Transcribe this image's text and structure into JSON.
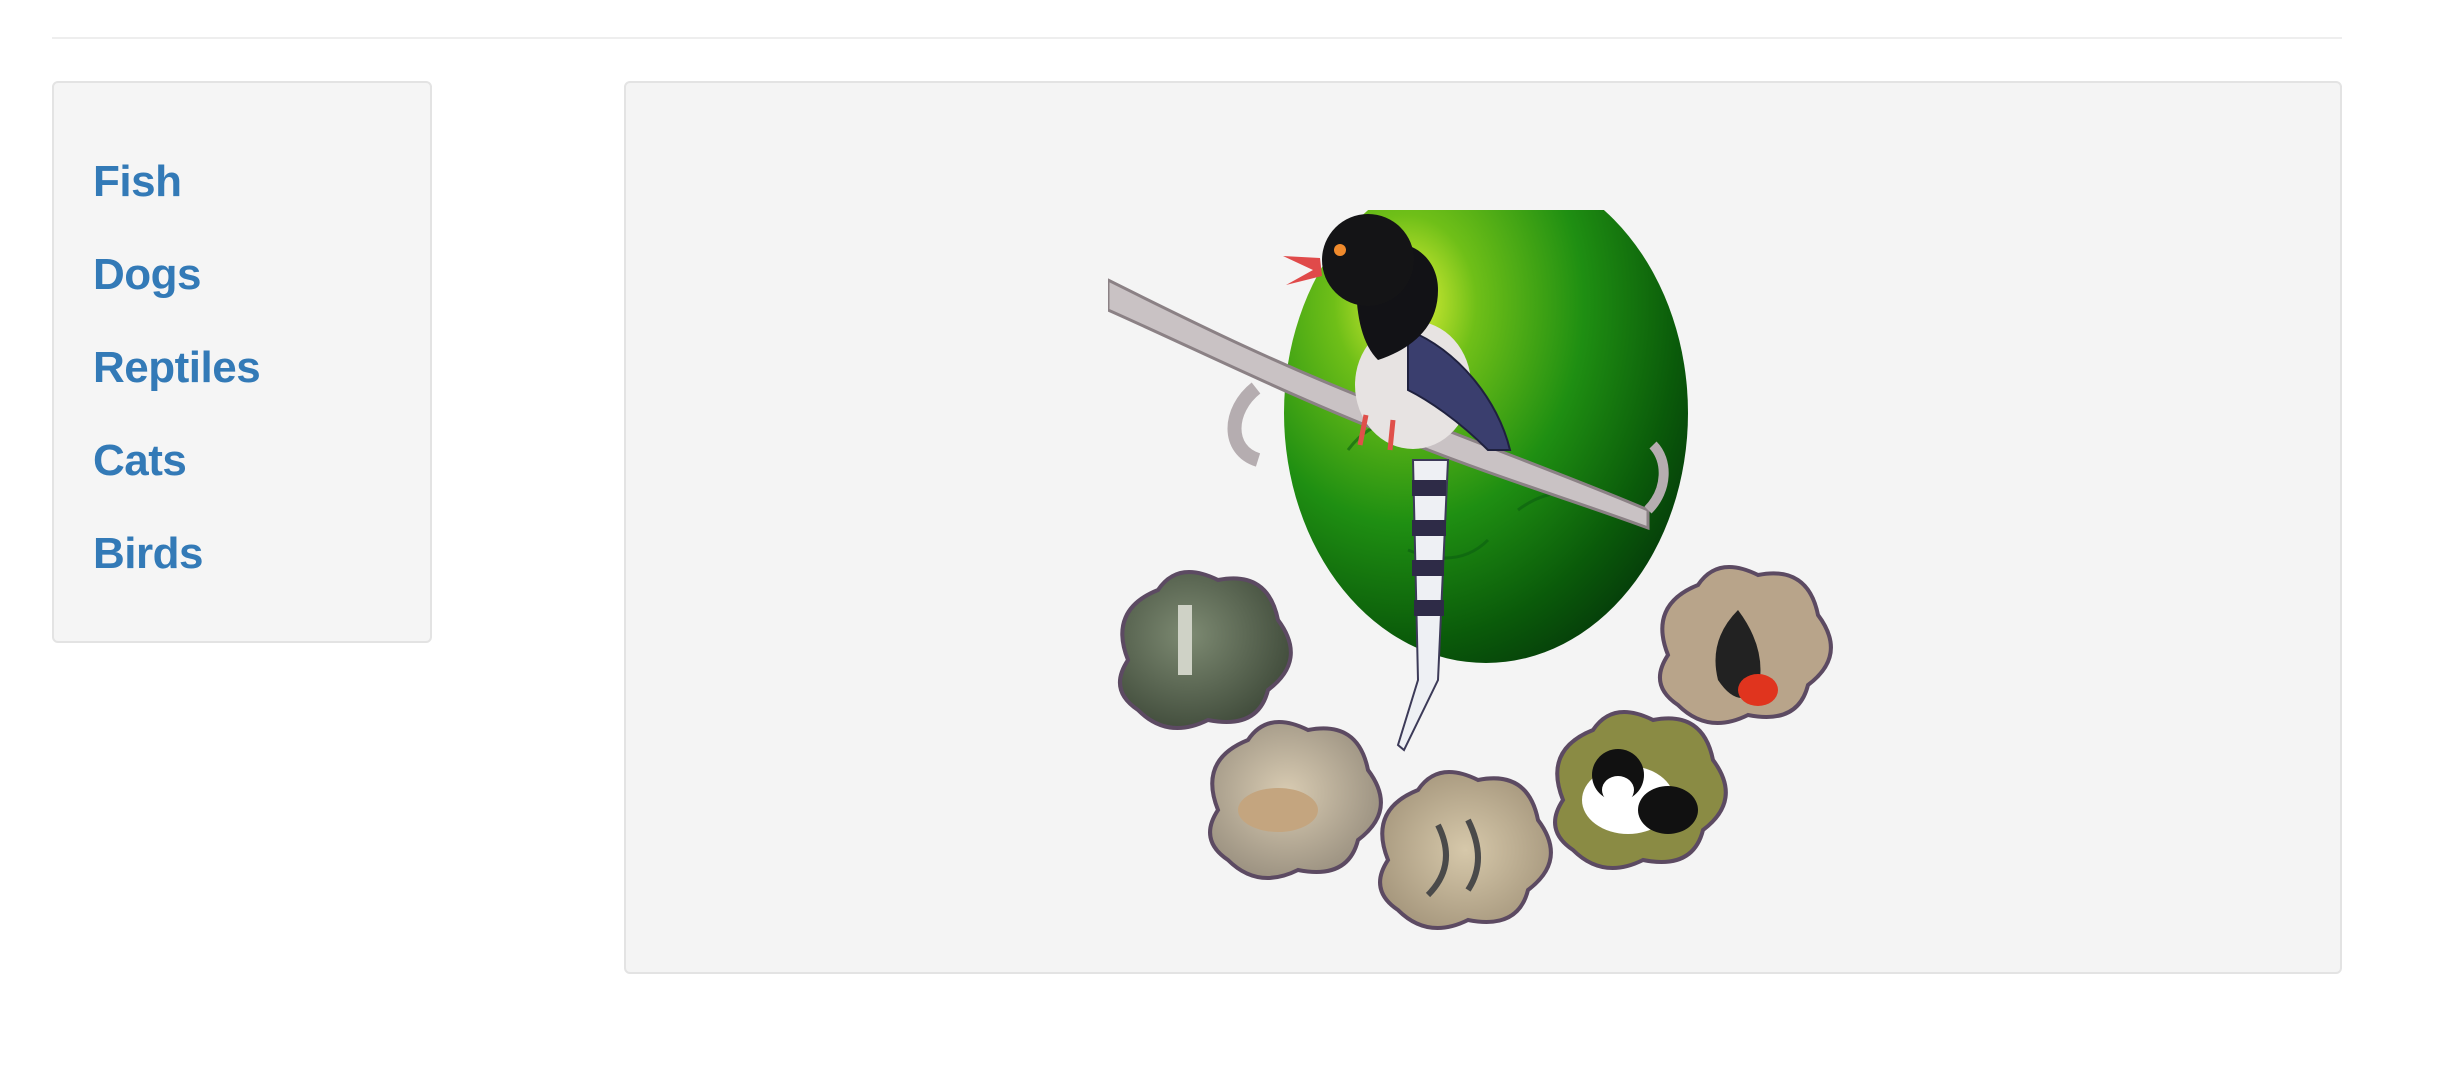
{
  "sidebar": {
    "items": [
      {
        "label": "Fish"
      },
      {
        "label": "Dogs"
      },
      {
        "label": "Reptiles"
      },
      {
        "label": "Cats"
      },
      {
        "label": "Birds"
      }
    ]
  },
  "main": {
    "image": "pet-store-splash-image",
    "thumbnails": [
      "reptile-thumbnail",
      "dog-thumbnail",
      "fish-thumbnail",
      "cat-thumbnail",
      "bird-thumbnail"
    ]
  },
  "colors": {
    "link": "#337ab7",
    "panel_background": "#f5f5f5",
    "panel_border": "#e3e3e3",
    "rule": "#eeeeee"
  }
}
